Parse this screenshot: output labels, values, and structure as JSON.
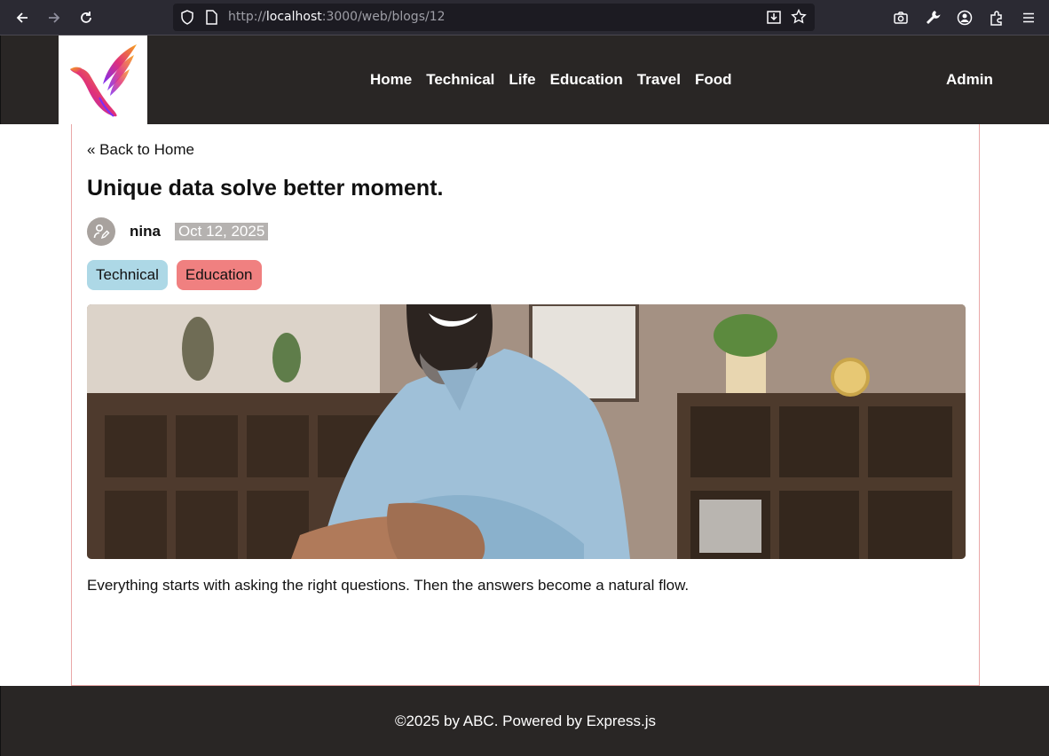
{
  "browser": {
    "url_prefix": "http://",
    "url_host": "localhost",
    "url_path": ":3000/web/blogs/12"
  },
  "header": {
    "logo_icon": "bird-logo-icon",
    "nav": [
      "Home",
      "Technical",
      "Life",
      "Education",
      "Travel",
      "Food"
    ],
    "admin": "Admin"
  },
  "post": {
    "back_link": "« Back to Home",
    "title": "Unique data solve better moment.",
    "author": "nina",
    "date": "Oct 12, 2025",
    "tags": [
      {
        "label": "Technical",
        "color": "#add8e6"
      },
      {
        "label": "Education",
        "color": "#f08080"
      }
    ],
    "body": "Everything starts with asking the right questions. Then the answers become a natural flow."
  },
  "footer": {
    "text": "©2025 by ABC. Powered by Express.js"
  }
}
